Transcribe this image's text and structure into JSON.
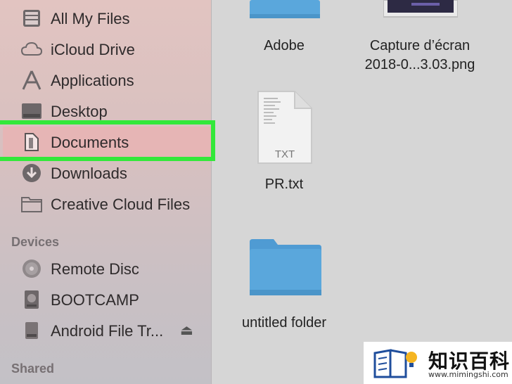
{
  "sidebar": {
    "favorites": [
      {
        "label": "All My Files",
        "icon": "all-files-icon"
      },
      {
        "label": "iCloud Drive",
        "icon": "cloud-icon"
      },
      {
        "label": "Applications",
        "icon": "applications-icon"
      },
      {
        "label": "Desktop",
        "icon": "desktop-icon"
      },
      {
        "label": "Documents",
        "icon": "documents-icon",
        "selected": true
      },
      {
        "label": "Downloads",
        "icon": "download-icon"
      },
      {
        "label": "Creative Cloud Files",
        "icon": "folder-icon"
      }
    ],
    "devices_header": "Devices",
    "devices": [
      {
        "label": "Remote Disc",
        "icon": "disc-icon"
      },
      {
        "label": "BOOTCAMP",
        "icon": "hard-drive-icon"
      },
      {
        "label": "Android File Tr...",
        "icon": "drive-icon",
        "eject": "⏏"
      }
    ],
    "shared_header": "Shared"
  },
  "files": [
    {
      "name": "Adobe",
      "type": "folder"
    },
    {
      "name_line1": "Capture d’écran",
      "name_line2": "2018-0...3.03.png",
      "type": "image"
    },
    {
      "name": "PR.txt",
      "type": "text",
      "ext": "TXT"
    },
    {
      "name": "untitled folder",
      "type": "folder"
    }
  ],
  "watermark": {
    "brand": "知识百科",
    "url": "www.mimingshi.com"
  },
  "colors": {
    "highlight": "#33e83a",
    "folder": "#5aa7dc",
    "selected": "#e6b5b5"
  }
}
